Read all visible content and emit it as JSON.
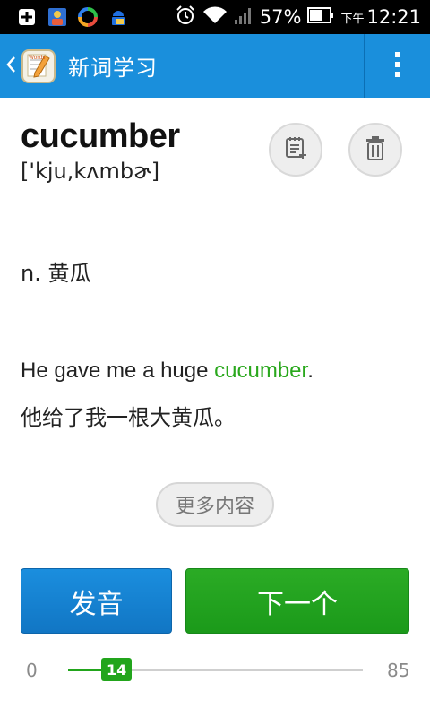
{
  "status_bar": {
    "battery_percent": "57%",
    "time_prefix": "下午",
    "time": "12:21",
    "icons": [
      "plus-box-icon",
      "photo-icon",
      "sync-icon",
      "android-lock-icon",
      "alarm-icon",
      "wifi-icon",
      "signal-icon",
      "battery-icon"
    ]
  },
  "action_bar": {
    "title": "新词学习",
    "back_icon": "chevron-left-icon",
    "logo_icon": "words-notebook-icon",
    "menu_icon": "overflow-menu-icon"
  },
  "word": {
    "term": "cucumber",
    "phonetic": "['kju,kʌmbɚ]",
    "definition": "n. 黄瓜",
    "example_before": "He gave me a huge ",
    "example_highlight": "cucumber",
    "example_after": ".",
    "example_translation": "他给了我一根大黄瓜。"
  },
  "actions": {
    "add_icon": "add-to-notebook-icon",
    "delete_icon": "trash-icon",
    "more_label": "更多内容",
    "pronounce_label": "发音",
    "next_label": "下一个"
  },
  "progress": {
    "min": "0",
    "max": "85",
    "current": "14",
    "current_value": 14,
    "max_value": 85
  },
  "colors": {
    "action_bar": "#1a8fdc",
    "accent_green": "#2aa81d",
    "pronounce_blue": "#1b8ede"
  }
}
